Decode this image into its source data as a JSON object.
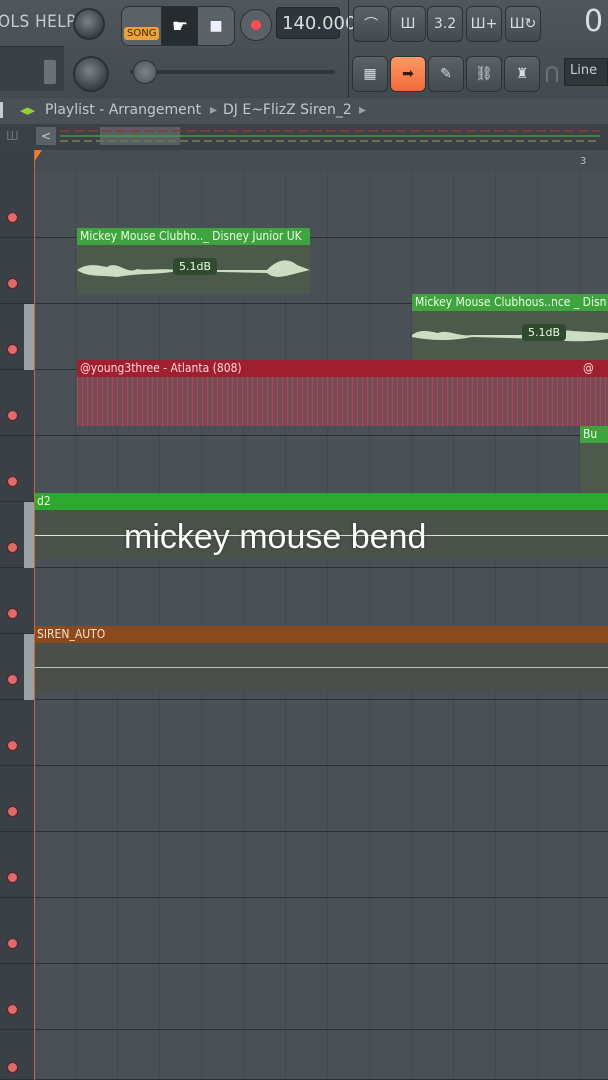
{
  "menu": {
    "tools_help": "OLS HELP"
  },
  "transport": {
    "song_label": "SONG",
    "tempo": "140.000",
    "time": "0"
  },
  "snap": {
    "value": "Line"
  },
  "playlist": {
    "title": "Playlist - Arrangement",
    "pattern_name": "DJ E~FlizZ Siren_2",
    "bar_marker": "3"
  },
  "clips": [
    {
      "name": "Mickey Mouse Clubho.._ Disney Junior UK",
      "db": "5.1dB"
    },
    {
      "name": "Mickey Mouse Clubhous..nce _ Disn",
      "db": "5.1dB"
    },
    {
      "name": "@young3three - Atlanta (808)"
    },
    {
      "name": "@"
    },
    {
      "name": "Bu"
    },
    {
      "name": "d2"
    },
    {
      "name": "SIREN_AUTO"
    }
  ],
  "caption": "mickey mouse bend",
  "colors": {
    "accent": "#f0a23a",
    "green_clip": "#3fb53f",
    "red_clip": "#9e1f2e",
    "orange_clip": "#8a4a1d",
    "playhead": "#d36b3a"
  }
}
